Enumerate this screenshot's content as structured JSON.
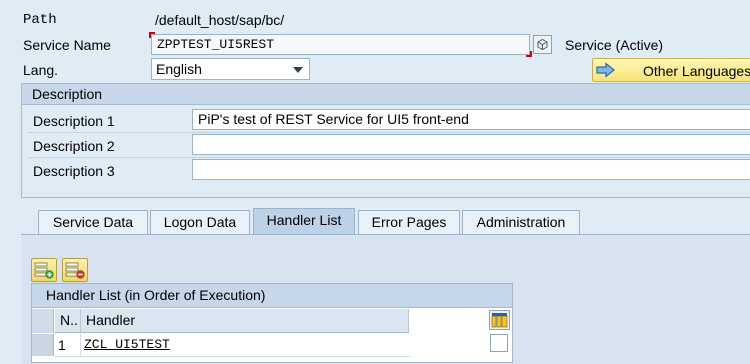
{
  "header": {
    "path_label": "Path",
    "path_value": "/default_host/sap/bc/",
    "service_name_label": "Service Name",
    "service_name_value": "ZPPTEST_UI5REST",
    "service_status": "Service (Active)",
    "lang_label": "Lang.",
    "lang_value": "English",
    "other_languages_label": "Other Languages"
  },
  "description": {
    "title": "Description",
    "rows": [
      {
        "label": "Description 1",
        "value": "PiP's test of REST Service for UI5 front-end"
      },
      {
        "label": "Description 2",
        "value": ""
      },
      {
        "label": "Description 3",
        "value": ""
      }
    ]
  },
  "tabs": [
    {
      "label": "Service Data",
      "active": false
    },
    {
      "label": "Logon Data",
      "active": false
    },
    {
      "label": "Handler List",
      "active": true
    },
    {
      "label": "Error Pages",
      "active": false
    },
    {
      "label": "Administration",
      "active": false
    }
  ],
  "toolbar": {
    "insert_row_icon": "insert-row-icon",
    "delete_row_icon": "delete-row-icon"
  },
  "handler_table": {
    "title": "Handler List (in Order of Execution)",
    "columns": [
      "N..",
      "Handler"
    ],
    "rows": [
      {
        "n": "1",
        "handler": "ZCL_UI5TEST"
      }
    ],
    "column_settings_icon": "column-settings-icon"
  },
  "colors": {
    "background": "#dfebf5",
    "button_yellow": "#f8e37a",
    "required_marker": "#d40000"
  }
}
